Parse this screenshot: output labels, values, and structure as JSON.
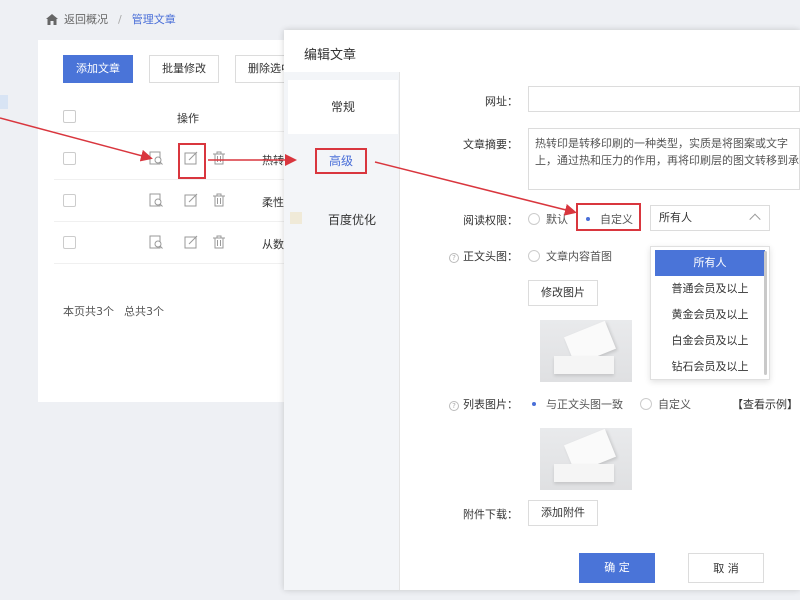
{
  "breadcrumb": {
    "back": "返回概况",
    "current": "管理文章"
  },
  "toolbar": {
    "add": "添加文章",
    "batch_edit": "批量修改",
    "delete_selected": "删除选中"
  },
  "list": {
    "ops_header": "操作",
    "rows": [
      {
        "title": "热转"
      },
      {
        "title": "柔性"
      },
      {
        "title": "从数"
      }
    ],
    "count_page": "本页共3个",
    "count_total": "总共3个"
  },
  "dialog": {
    "title": "编辑文章",
    "tabs": [
      "常规",
      "高级",
      "百度优化"
    ],
    "url_label": "网址：",
    "summary_label": "文章摘要：",
    "summary_lines": [
      "热转印是转移印刷的一种类型，实质是将图案或文字",
      "上，通过热和压力的作用，再将印刷层的图文转移到承"
    ],
    "perm_label": "阅读权限：",
    "perm_options": [
      "默认",
      "自定义"
    ],
    "perm_selected": "所有人",
    "perm_dropdown": [
      "所有人",
      "普通会员及以上",
      "黄金会员及以上",
      "白金会员及以上",
      "钻石会员及以上"
    ],
    "header_img_label": "正文头图：",
    "header_img_option": "文章内容首图",
    "modify_image": "修改图片",
    "list_img_label": "列表图片：",
    "list_img_options": [
      "与正文头图一致",
      "自定义"
    ],
    "view_example": "【查看示例】",
    "attach_label": "附件下载：",
    "add_attach": "添加附件",
    "ok": "确 定",
    "cancel": "取 消"
  },
  "colors": {
    "primary": "#4a74d8",
    "highlight": "#d9363e"
  }
}
